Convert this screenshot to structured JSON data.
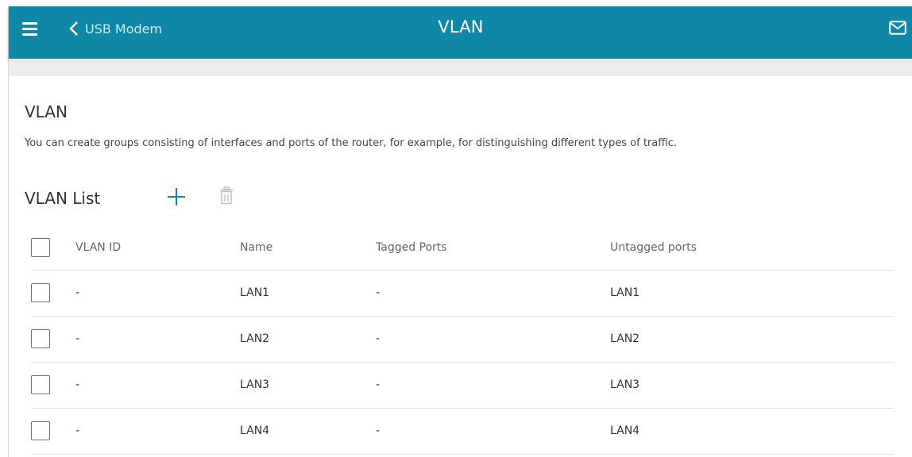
{
  "header": {
    "back_label": "USB Modem",
    "title": "VLAN",
    "bar_color": "#0f87a6"
  },
  "section": {
    "title": "VLAN",
    "description": "You can create groups consisting of interfaces and ports of the router, for example, for distinguishing different types of traffic."
  },
  "vlan_list": {
    "title": "VLAN List",
    "add_icon": "plus-icon",
    "delete_icon": "trash-icon",
    "columns": [
      "VLAN ID",
      "Name",
      "Tagged Ports",
      "Untagged ports"
    ],
    "rows": [
      {
        "vlan_id": "-",
        "name": "LAN1",
        "tagged": "-",
        "untagged": "LAN1"
      },
      {
        "vlan_id": "-",
        "name": "LAN2",
        "tagged": "-",
        "untagged": "LAN2"
      },
      {
        "vlan_id": "-",
        "name": "LAN3",
        "tagged": "-",
        "untagged": "LAN3"
      },
      {
        "vlan_id": "-",
        "name": "LAN4",
        "tagged": "-",
        "untagged": "LAN4"
      }
    ]
  }
}
